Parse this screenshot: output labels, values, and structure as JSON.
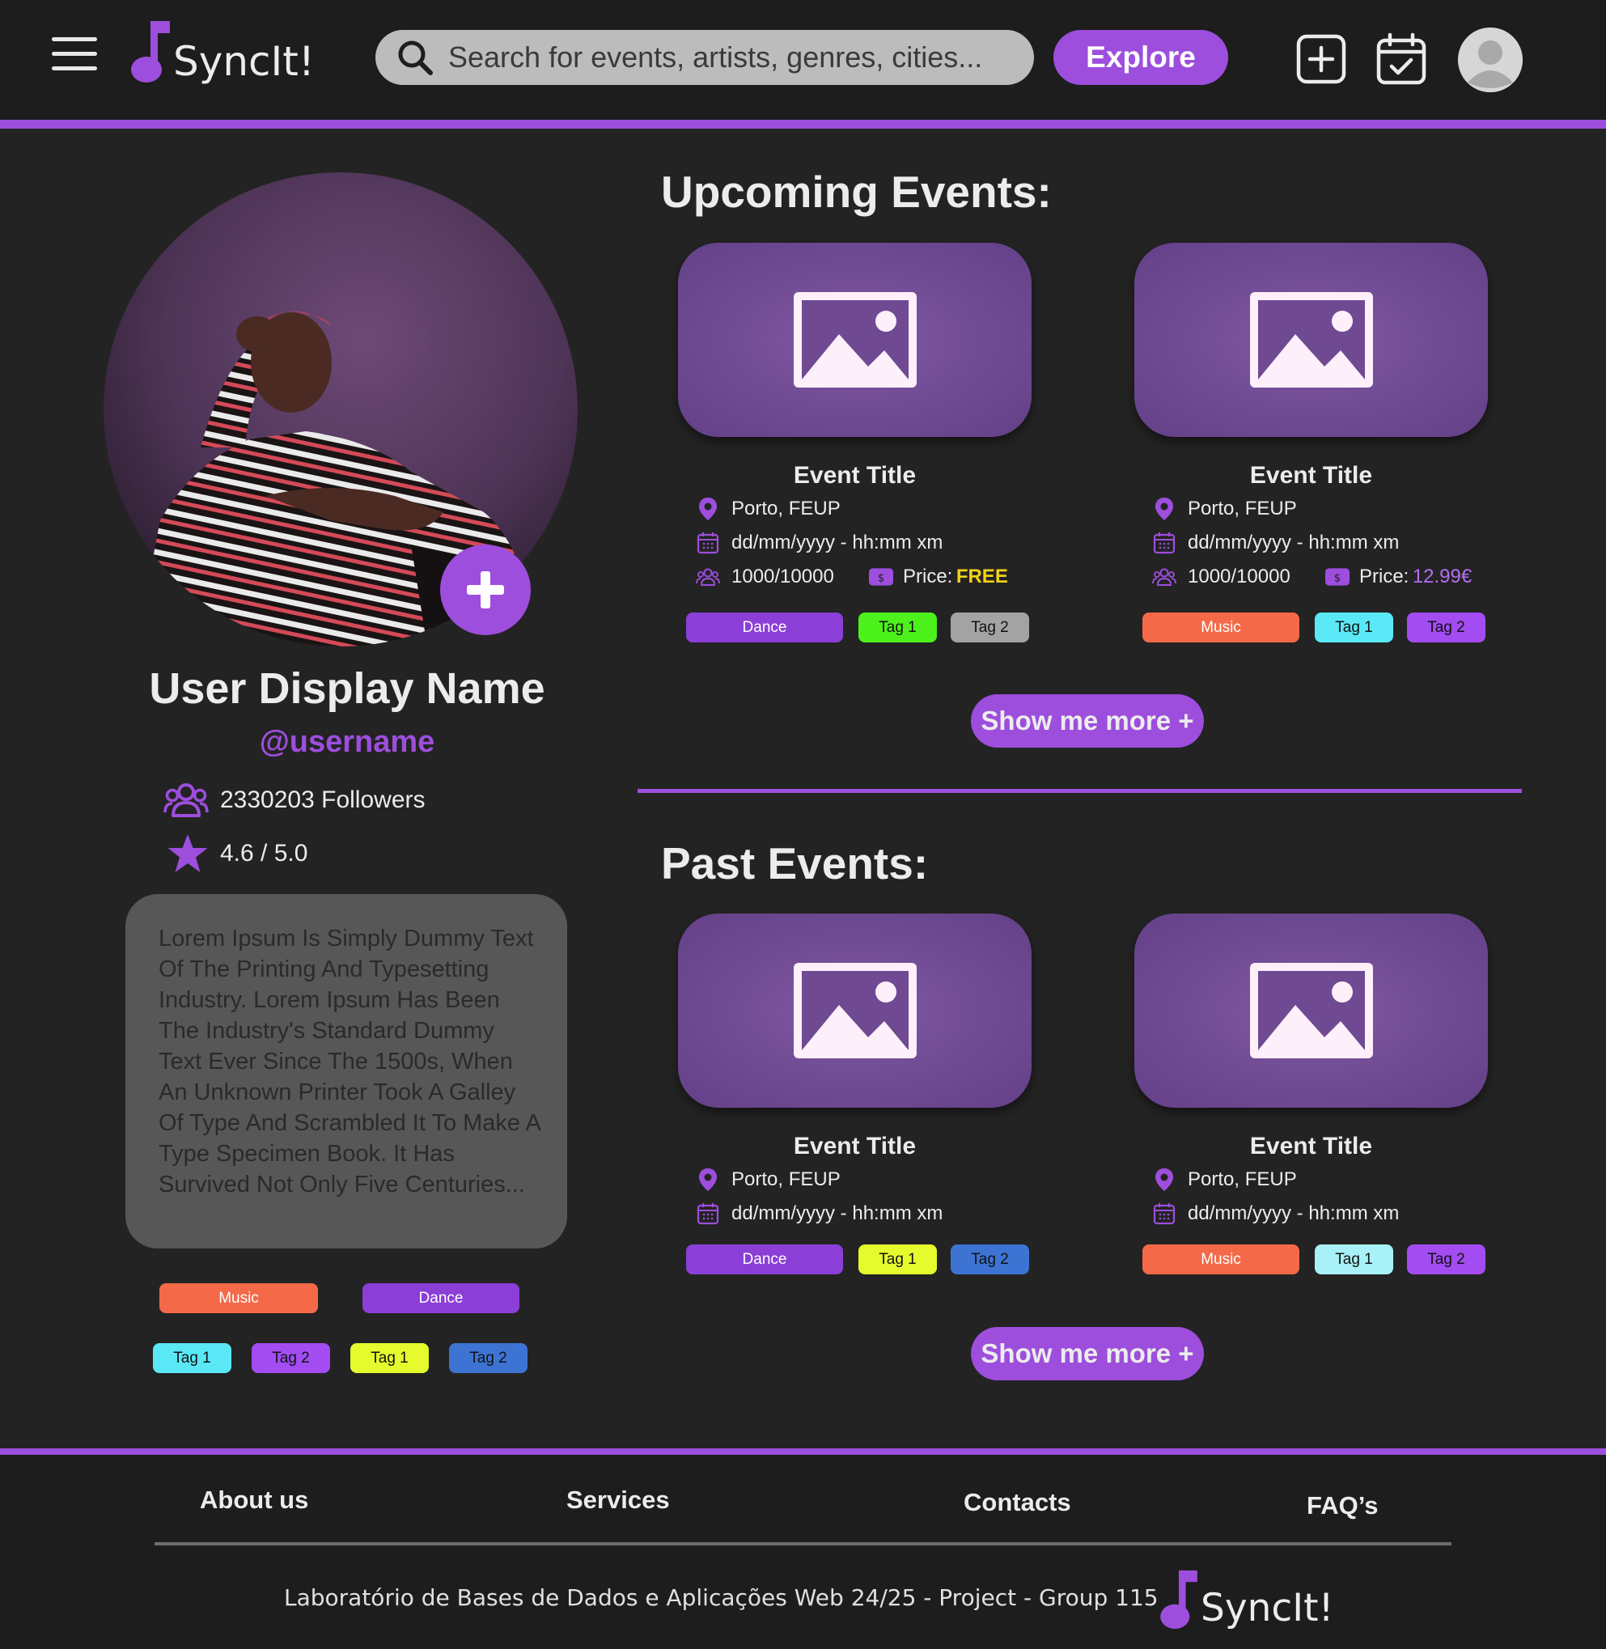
{
  "header": {
    "logo_text": "SyncIt!",
    "search_placeholder": "Search for events, artists, genres, cities...",
    "explore_label": "Explore"
  },
  "profile": {
    "display_name": "User Display Name",
    "username": "@username",
    "followers": "2330203 Followers",
    "rating": "4.6 / 5.0",
    "bio": "Lorem Ipsum Is Simply Dummy Text Of The Printing And Typesetting Industry. Lorem Ipsum Has Been The Industry's Standard Dummy Text Ever Since The 1500s, When An Unknown Printer Took A Galley Of Type And Scrambled It To Make A Type Specimen Book. It Has Survived Not Only Five Centuries...",
    "genres": [
      "Music",
      "Dance"
    ],
    "tags": [
      "Tag 1",
      "Tag 2",
      "Tag 1",
      "Tag 2"
    ]
  },
  "upcoming": {
    "title": "Upcoming Events:",
    "more_label": "Show me more +",
    "events": [
      {
        "title": "Event Title",
        "location": "Porto, FEUP",
        "datetime": "dd/mm/yyyy - hh:mm xm",
        "capacity": "1000/10000",
        "price_label": "Price:",
        "price": "FREE",
        "tags": [
          "Dance",
          "Tag 1",
          "Tag 2"
        ]
      },
      {
        "title": "Event Title",
        "location": "Porto, FEUP",
        "datetime": "dd/mm/yyyy - hh:mm xm",
        "capacity": "1000/10000",
        "price_label": "Price:",
        "price": "12.99€",
        "tags": [
          "Music",
          "Tag 1",
          "Tag 2"
        ]
      }
    ]
  },
  "past": {
    "title": "Past Events:",
    "more_label": "Show me more +",
    "events": [
      {
        "title": "Event Title",
        "location": "Porto, FEUP",
        "datetime": "dd/mm/yyyy - hh:mm xm",
        "tags": [
          "Dance",
          "Tag 1",
          "Tag 2"
        ]
      },
      {
        "title": "Event Title",
        "location": "Porto, FEUP",
        "datetime": "dd/mm/yyyy - hh:mm xm",
        "tags": [
          "Music",
          "Tag 1",
          "Tag 2"
        ]
      }
    ]
  },
  "footer": {
    "links": [
      "About us",
      "Services",
      "Contacts",
      "FAQ’s"
    ],
    "credit": "Laboratório de Bases de Dados e Aplicações Web  24/25 - Project - Group 115",
    "logo_text": "SyncIt!"
  },
  "colors": {
    "accent": "#9d4edd",
    "background": "#232323",
    "tag_orange": "#f46a49",
    "tag_purple": "#8b3fd6",
    "tag_cyan": "#5ae8f6",
    "tag_lime": "#e5fb2d",
    "tag_green": "#4df21c",
    "tag_grey": "#a3a3a3",
    "tag_blue": "#3d74d4",
    "tag_light_purple": "#a24cf2",
    "price_free": "#f2d21a"
  }
}
